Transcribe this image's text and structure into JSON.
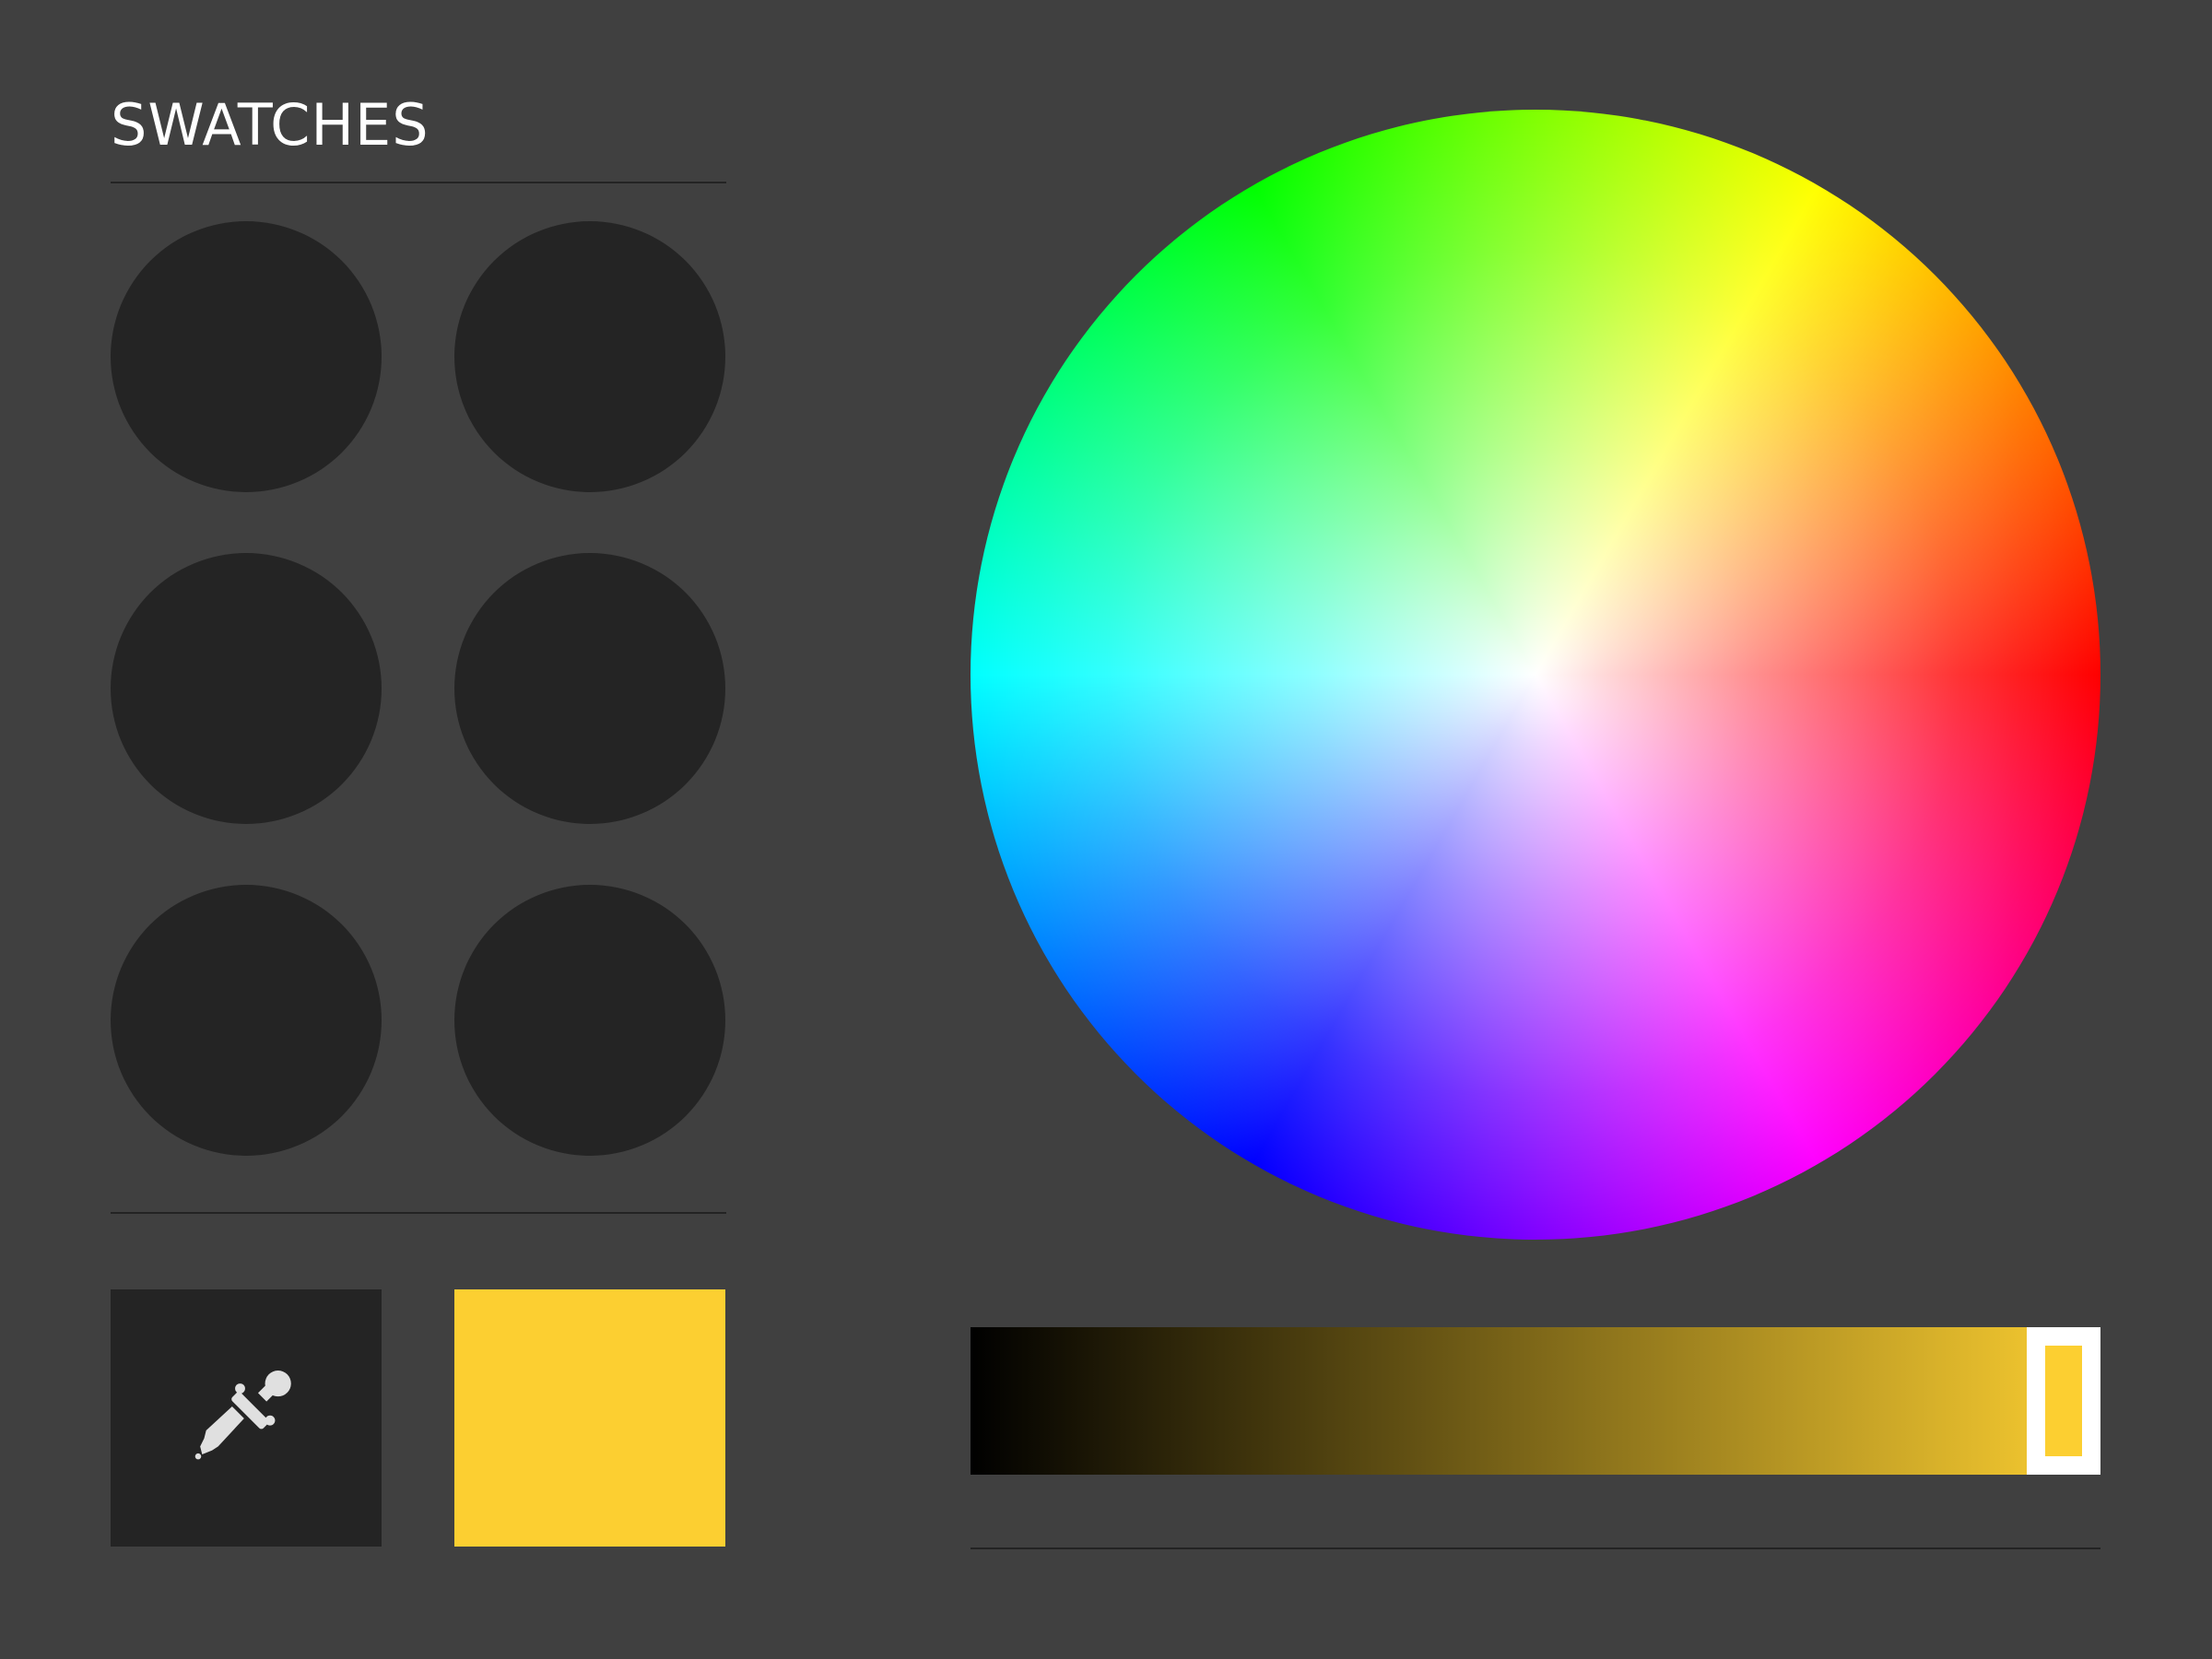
{
  "panel": {
    "title": "SWATCHES"
  },
  "swatches": [
    {
      "color": "#242424"
    },
    {
      "color": "#242424"
    },
    {
      "color": "#242424"
    },
    {
      "color": "#242424"
    },
    {
      "color": "#242424"
    },
    {
      "color": "#242424"
    }
  ],
  "eyedropper": {
    "icon": "eyedropper-icon",
    "icon_color": "#e0e0e0"
  },
  "current_color": {
    "hex": "#fccf31"
  },
  "color_wheel": {
    "type": "hue-saturation-wheel"
  },
  "brightness_slider": {
    "color": "#fccf31",
    "value": 0.97
  }
}
